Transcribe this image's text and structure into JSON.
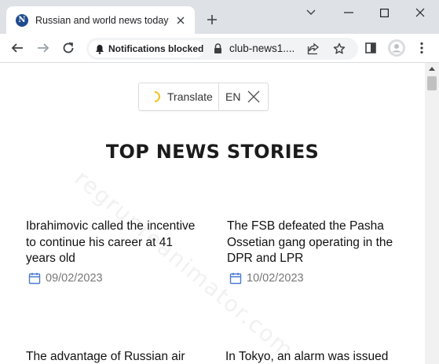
{
  "browser": {
    "tab_title": "Russian and world news today",
    "favicon_letter": "N",
    "notification_chip": "Notifications blocked",
    "url": "club-news1....",
    "colors": {
      "chrome_bg": "#dee1e6",
      "favicon_bg": "#1f4b8f"
    }
  },
  "translate": {
    "label": "Translate",
    "language": "EN",
    "spinner_color": "#f3c11d"
  },
  "page": {
    "headline": "TOP NEWS STORIES",
    "watermark": "regrunreanimator.com",
    "articles": [
      {
        "title": "Ibrahimovic called the incentive to continue his career at 41 years old",
        "date": "09/02/2023"
      },
      {
        "title": "The FSB defeated the Pasha Ossetian gang operating in the DPR and LPR",
        "date": "10/02/2023"
      },
      {
        "title": "The advantage of Russian air",
        "date": ""
      },
      {
        "title": "In Tokyo, an alarm was issued",
        "date": ""
      }
    ],
    "date_icon_color": "#4a7bd0"
  },
  "icons": {
    "tab_close": "close-icon",
    "new_tab": "plus-icon",
    "back": "arrow-left-icon",
    "forward": "arrow-right-icon",
    "reload": "reload-icon",
    "notification": "bell-icon",
    "lock": "lock-icon",
    "share": "share-icon",
    "bookmark": "star-icon",
    "sidebar": "side-panel-icon",
    "profile": "profile-avatar",
    "menu": "kebab-menu-icon"
  }
}
